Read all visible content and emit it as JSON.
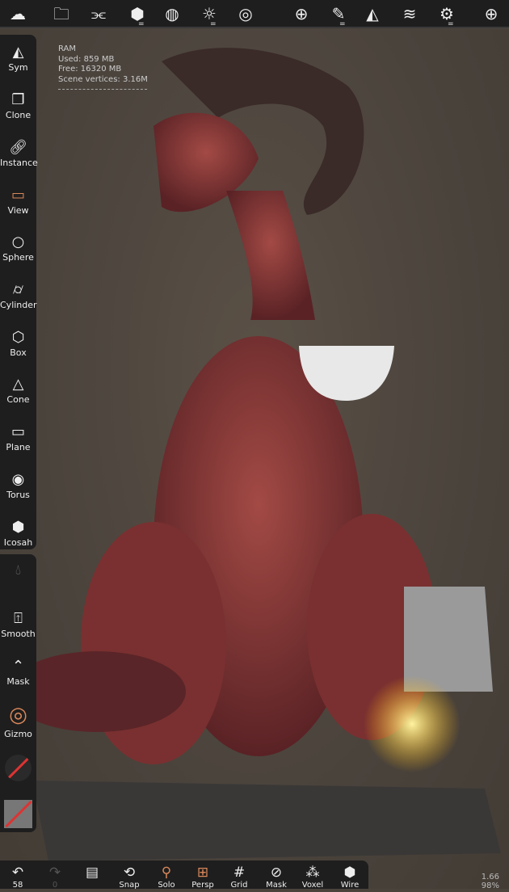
{
  "topbar": {
    "icons": [
      "cloud-logo-icon",
      "folder-icon",
      "scene-graph-icon",
      "mesh-topology-icon",
      "material-sphere-icon",
      "light-icon",
      "shading-icon",
      "add-layer-icon",
      "brush-icon",
      "symmetry-icon",
      "layers-icon",
      "settings-icon",
      "add-object-icon"
    ]
  },
  "stats": {
    "title": "RAM",
    "used": "Used: 859 MB",
    "free": "Free: 16320 MB",
    "vertices": "Scene vertices: 3.16M"
  },
  "sidebar_top": [
    {
      "label": "Sym",
      "icon": "symmetry-icon"
    },
    {
      "label": "Clone",
      "icon": "clone-icon"
    },
    {
      "label": "Instance",
      "icon": "link-icon"
    },
    {
      "label": "View",
      "icon": "camera-icon"
    },
    {
      "label": "Sphere",
      "icon": "sphere-icon"
    },
    {
      "label": "Cylinder",
      "icon": "cylinder-icon"
    },
    {
      "label": "Box",
      "icon": "box-icon"
    },
    {
      "label": "Cone",
      "icon": "cone-icon"
    },
    {
      "label": "Plane",
      "icon": "plane-icon"
    },
    {
      "label": "Torus",
      "icon": "torus-icon"
    },
    {
      "label": "Icosah",
      "icon": "icosahedron-icon"
    }
  ],
  "sidebar_bottom": [
    {
      "label": "Smooth",
      "icon": "smooth-icon"
    },
    {
      "label": "Mask",
      "icon": "mask-icon"
    },
    {
      "label": "Gizmo",
      "icon": "gizmo-icon"
    }
  ],
  "bottombar": [
    {
      "label": "58",
      "icon": "undo-icon"
    },
    {
      "label": "0",
      "icon": "redo-icon"
    },
    {
      "label": "",
      "icon": "history-icon"
    },
    {
      "label": "Snap",
      "icon": "snap-icon"
    },
    {
      "label": "Solo",
      "icon": "solo-icon"
    },
    {
      "label": "Persp",
      "icon": "perspective-icon"
    },
    {
      "label": "Grid",
      "icon": "grid-icon"
    },
    {
      "label": "Mask",
      "icon": "mask-hide-icon"
    },
    {
      "label": "Voxel",
      "icon": "voxel-icon"
    },
    {
      "label": "Wire",
      "icon": "wireframe-icon"
    }
  ],
  "corner": {
    "line1": "1.66",
    "line2": "98%"
  },
  "colors": {
    "bar": "#1e1e1e",
    "accent": "#d9875a",
    "background": "#4a433c"
  }
}
